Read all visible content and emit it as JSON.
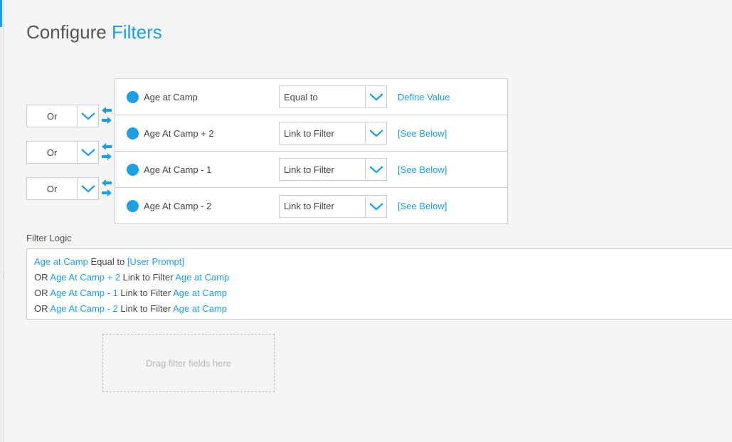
{
  "page": {
    "title_part1": "Configure",
    "title_part2": "Filters"
  },
  "conjunctions": [
    {
      "label": "Or"
    },
    {
      "label": "Or"
    },
    {
      "label": "Or"
    }
  ],
  "filters": [
    {
      "name": "Age at Camp",
      "operator": "Equal to",
      "value_link": "Define Value"
    },
    {
      "name": "Age At Camp + 2",
      "operator": "Link to Filter",
      "value_link": "[See Below]"
    },
    {
      "name": "Age At Camp - 1",
      "operator": "Link to Filter",
      "value_link": "[See Below]"
    },
    {
      "name": "Age At Camp - 2",
      "operator": "Link to Filter",
      "value_link": "[See Below]"
    }
  ],
  "filter_logic": {
    "heading": "Filter Logic",
    "lines": [
      {
        "prefix": "",
        "field": "Age at Camp",
        "op": " Equal to ",
        "target": "[User Prompt]"
      },
      {
        "prefix": "OR ",
        "field": "Age At Camp + 2",
        "op": " Link to Filter ",
        "target": "Age at Camp"
      },
      {
        "prefix": "OR ",
        "field": "Age At Camp - 1",
        "op": " Link to Filter ",
        "target": "Age at Camp"
      },
      {
        "prefix": "OR ",
        "field": "Age At Camp - 2",
        "op": " Link to Filter ",
        "target": "Age at Camp"
      }
    ]
  },
  "dropzone": {
    "text": "Drag filter fields here"
  },
  "colors": {
    "accent": "#1e9ee3",
    "border": "#cccccc",
    "background": "#f5f5f5"
  },
  "icons": {
    "select_toggle": "chevron-down-icon",
    "reorder": "swap-arrows-icon",
    "bullet": "filter-dot-icon"
  }
}
